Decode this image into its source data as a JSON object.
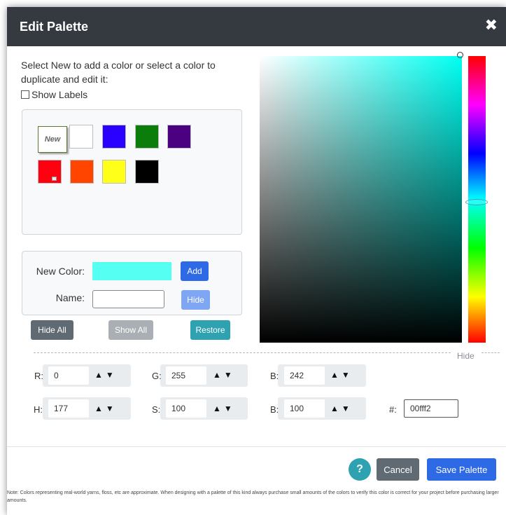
{
  "dialog": {
    "title": "Edit Palette",
    "close_glyph": "✖"
  },
  "intro": {
    "text": "Select New to add a color or select a color to duplicate and edit it:",
    "show_labels": "Show Labels"
  },
  "palette": {
    "new_label": "New",
    "swatches": [
      {
        "color": "#ffffff"
      },
      {
        "color": "#2a00ff"
      },
      {
        "color": "#0a7d0a"
      },
      {
        "color": "#4b0082"
      },
      {
        "color": "#ff0010"
      },
      {
        "color": "#ff4500"
      },
      {
        "color": "#ffff1a"
      },
      {
        "color": "#000000"
      }
    ]
  },
  "new_color": {
    "label": "New Color:",
    "name_label": "Name:",
    "swatch_color": "#55fff2",
    "add_button": "Add",
    "hide_button": "Hide"
  },
  "actions": {
    "hide_all": "Hide All",
    "show_all": "Show All",
    "restore": "Restore"
  },
  "picker": {
    "hide_link": "Hide",
    "base_hue_color": "#00fff2"
  },
  "fields": {
    "r_label": "R:",
    "r_value": "0",
    "g_label": "G:",
    "g_value": "255",
    "b_label": "B:",
    "b_value": "242",
    "h_label": "H:",
    "h_value": "177",
    "s_label": "S:",
    "s_value": "100",
    "v_label": "B:",
    "v_value": "100",
    "hex_label": "#:",
    "hex_value": "00fff2",
    "arrows": "▲▼"
  },
  "footer": {
    "help": "?",
    "cancel": "Cancel",
    "save": "Save Palette",
    "note": "Note: Colors representing real-world yarns, floss, etc are approximate. When designing with a palette of this kind always purchase small amounts of the colors to verify this color is correct for your project before purchasing larger amounts."
  }
}
